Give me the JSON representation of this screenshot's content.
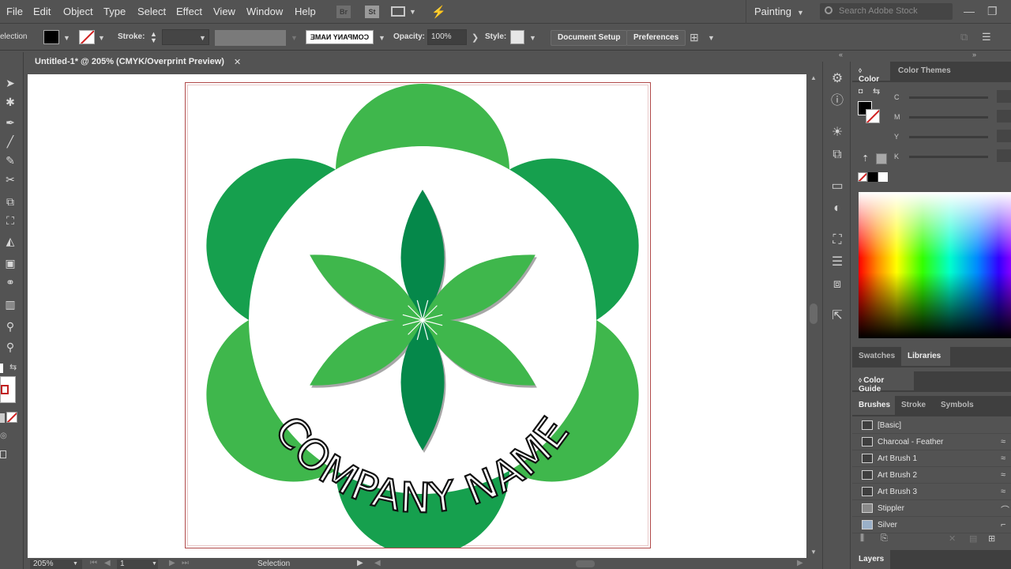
{
  "menu": [
    "File",
    "Edit",
    "Object",
    "Type",
    "Select",
    "Effect",
    "View",
    "Window",
    "Help"
  ],
  "menu_icons": {
    "bridge": "Br",
    "stock": "St"
  },
  "workspace": "Painting",
  "search_placeholder": "Search Adobe Stock",
  "control": {
    "mode_label": "election",
    "stroke_label": "Stroke:",
    "font_preview": "COMPANY NAME",
    "opacity_label": "Opacity:",
    "opacity_value": "100%",
    "style_label": "Style:",
    "document_setup": "Document Setup",
    "preferences": "Preferences"
  },
  "document": {
    "tab_title": "Untitled-1* @ 205% (CMYK/Overprint Preview)",
    "close": "✕"
  },
  "artwork": {
    "text": "COMPANY NAME",
    "colors": {
      "dark": "#05884a",
      "mid": "#16a04e",
      "light": "#3fb74c",
      "shadow": "#a7a7a7"
    }
  },
  "status": {
    "zoom": "205%",
    "artboard": "1",
    "tool": "Selection"
  },
  "color_panel": {
    "tabs": [
      "Color",
      "Color Themes"
    ],
    "sliders": [
      "C",
      "M",
      "Y",
      "K"
    ]
  },
  "library_tabs": [
    "Swatches",
    "Libraries"
  ],
  "color_guide": "Color Guide",
  "brush_tabs": [
    "Brushes",
    "Stroke",
    "Symbols"
  ],
  "brushes": [
    "[Basic]",
    "Charcoal - Feather",
    "Art Brush 1",
    "Art Brush 2",
    "Art Brush 3",
    "Stippler",
    "Silver"
  ],
  "layers": "Layers"
}
